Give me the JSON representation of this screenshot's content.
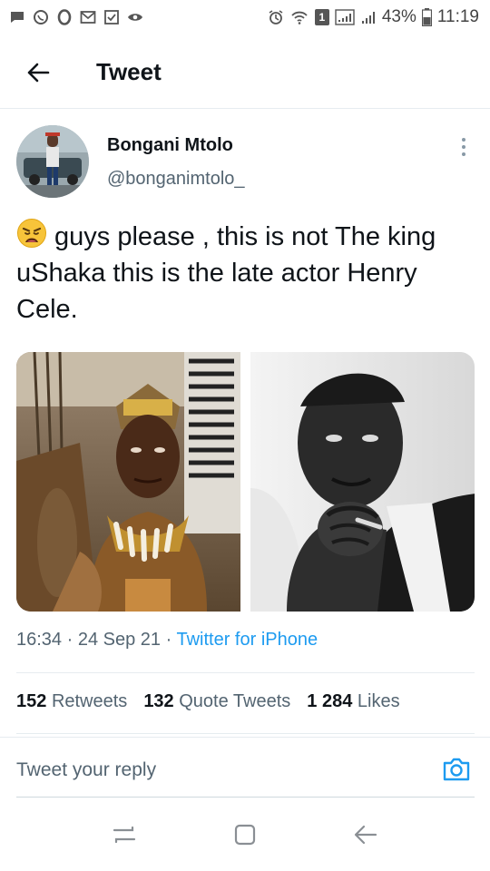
{
  "status_bar": {
    "battery": "43%",
    "time": "11:19",
    "sim_badge": "1"
  },
  "header": {
    "title": "Tweet"
  },
  "tweet": {
    "author_name": "Bongani Mtolo",
    "author_handle": "@bonganimtolo_",
    "emoji": "weary-face",
    "text": "guys please , this is not The king uShaka this is the late actor Henry Cele.",
    "time": "16:34",
    "date": "24 Sep 21",
    "source": "Twitter for iPhone"
  },
  "stats": {
    "retweets_count": "152",
    "retweets_label": "Retweets",
    "quote_count": "132",
    "quote_label": "Quote Tweets",
    "likes_count": "1 284",
    "likes_label": "Likes"
  },
  "reply": {
    "placeholder": "Tweet your reply"
  },
  "colors": {
    "accent": "#1d9bf0",
    "text": "#0f1419",
    "secondary": "#536471"
  }
}
